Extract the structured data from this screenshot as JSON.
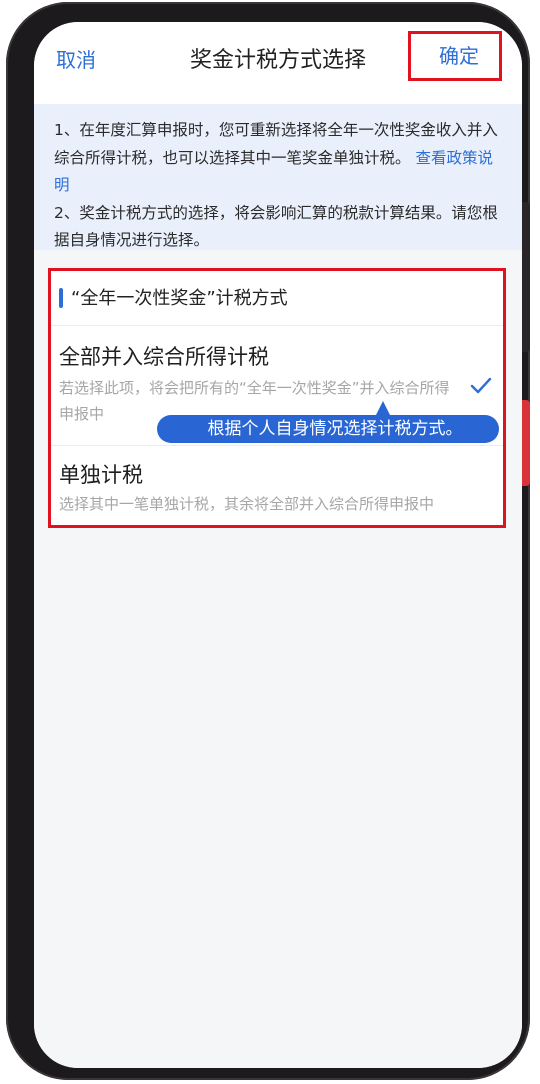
{
  "nav": {
    "cancel": "取消",
    "title": "奖金计税方式选择",
    "confirm": "确定"
  },
  "notice": {
    "line1": "1、在年度汇算申报时，您可重新选择将全年一次性奖金收入并入综合所得计税，也可以选择其中一笔奖金单独计税。",
    "line1_link": "查看政策说明",
    "line2": "2、奖金计税方式的选择，将会影响汇算的税款计算结果。请您根据自身情况进行选择。"
  },
  "section": {
    "title": "“全年一次性奖金”计税方式",
    "options": [
      {
        "title": "全部并入综合所得计税",
        "desc": "若选择此项，将会把所有的“全年一次性奖金”并入综合所得申报中",
        "selected": true
      },
      {
        "title": "单独计税",
        "desc": "选择其中一笔单独计税，其余将全部并入综合所得申报中",
        "selected": false
      }
    ]
  },
  "tooltip": {
    "text": "根据个人自身情况选择计税方式。"
  },
  "colors": {
    "accent": "#2d6fd6",
    "highlight_border": "#e0121f",
    "notice_bg": "#e9f0fb",
    "tooltip_bg": "#2966d4"
  },
  "icons": {
    "check": "check-icon"
  }
}
